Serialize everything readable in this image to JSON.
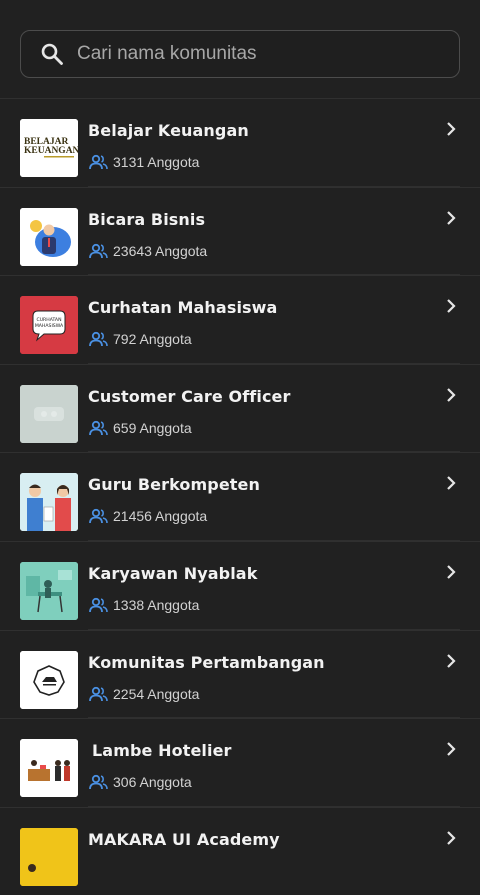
{
  "search": {
    "placeholder": "Cari nama komunitas",
    "icon": "search-icon"
  },
  "communities": [
    {
      "name": "Belajar Keuangan",
      "members": "3131 Anggota",
      "thumb_text": "BELAJAR KEUANGAN",
      "thumb_bg": "#ffffff"
    },
    {
      "name": "Bicara Bisnis",
      "members": "23643 Anggota",
      "thumb_bg": "#ffffff"
    },
    {
      "name": "Curhatan Mahasiswa",
      "members": "792 Anggota",
      "thumb_text": "CURHATAN MAHASISWA",
      "thumb_bg": "#d63a43"
    },
    {
      "name": "Customer Care Officer",
      "members": "659 Anggota",
      "thumb_bg": "#c9d3cf"
    },
    {
      "name": "Guru Berkompeten",
      "members": "21456 Anggota",
      "thumb_bg": "#d8eef2"
    },
    {
      "name": "Karyawan Nyablak",
      "members": "1338 Anggota",
      "thumb_bg": "#7fcfbd"
    },
    {
      "name": "Komunitas Pertambangan",
      "members": "2254 Anggota",
      "thumb_bg": "#ffffff"
    },
    {
      "name": "Lambe Hotelier",
      "members": "306 Anggota",
      "thumb_bg": "#ffffff"
    },
    {
      "name": "MAKARA UI Academy",
      "members": "",
      "thumb_bg": "#f0c419"
    }
  ],
  "colors": {
    "background": "#212121",
    "accent_icon": "#4a90e2",
    "text": "#f2f2f2",
    "subtext": "#d2d2d2"
  }
}
